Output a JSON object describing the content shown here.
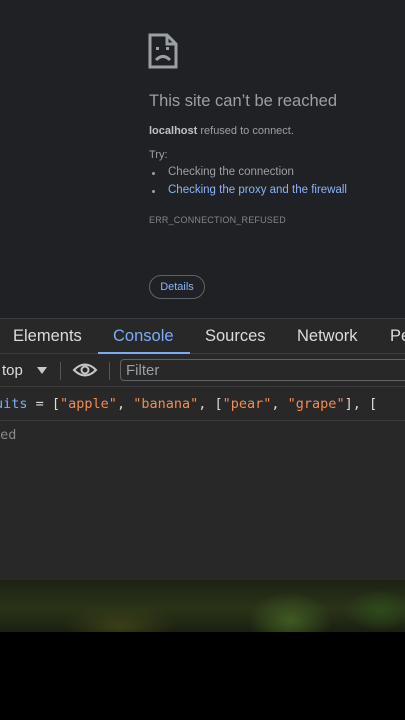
{
  "error_page": {
    "title": "This site can’t be reached",
    "host": "localhost",
    "description_rest": " refused to connect.",
    "try_label": "Try:",
    "suggestions": [
      "Checking the connection",
      "Checking the proxy and the firewall"
    ],
    "error_code": "ERR_CONNECTION_REFUSED",
    "details_button": "Details"
  },
  "devtools": {
    "tabs": [
      {
        "label": "Elements",
        "active": false
      },
      {
        "label": "Console",
        "active": true
      },
      {
        "label": "Sources",
        "active": false
      },
      {
        "label": "Network",
        "active": false
      },
      {
        "label": "Pe",
        "active": false
      }
    ],
    "toolbar": {
      "context": "top",
      "filter_placeholder": "Filter"
    },
    "console": {
      "input_tokens": {
        "ident": "uits",
        "op": " = [",
        "s1": "\"apple\"",
        "c1": ", ",
        "s2": "\"banana\"",
        "c2": ", [",
        "s3": "\"pear\"",
        "c3": ", ",
        "s4": "\"grape\"",
        "c4": "], ["
      },
      "result": "ned"
    }
  },
  "colors": {
    "link": "#8ab4f8",
    "active_tab": "#7cacf8",
    "string": "#f28b54",
    "background": "#202124",
    "devtools_bg": "#282828"
  }
}
